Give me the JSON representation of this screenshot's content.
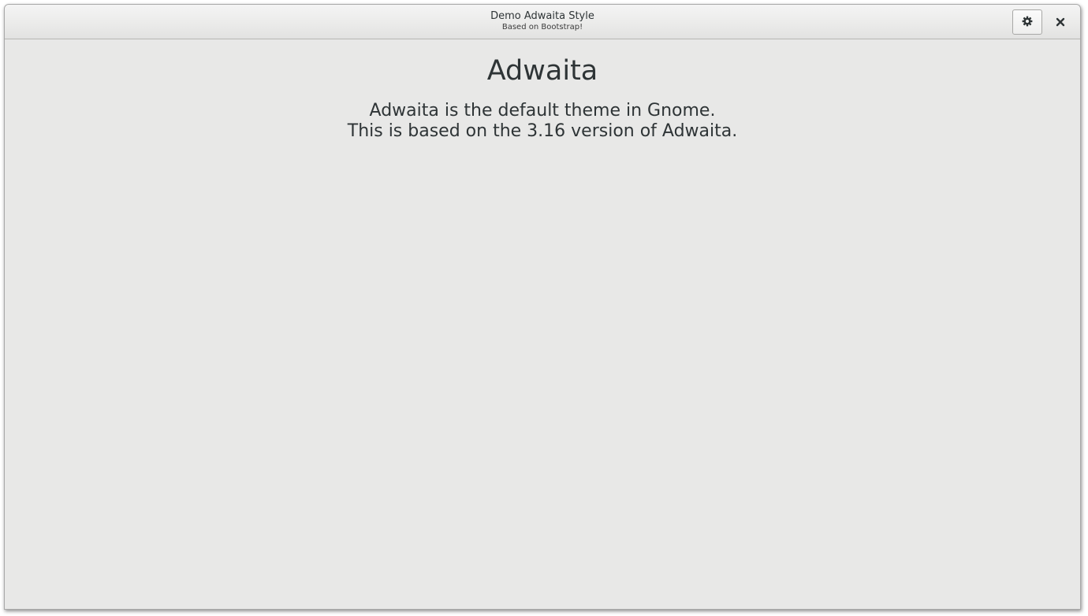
{
  "window": {
    "title": "Demo Adwaita Style",
    "subtitle": "Based on Bootstrap!"
  },
  "headerbar": {
    "settings_icon": "gear-icon",
    "close_icon": "close-icon"
  },
  "main": {
    "heading": "Adwaita",
    "lead_line1": "Adwaita is the default theme in Gnome.",
    "lead_line2": "This is based on the 3.16 version of Adwaita."
  },
  "colors": {
    "background": "#e8e8e7",
    "text": "#2e3436"
  }
}
